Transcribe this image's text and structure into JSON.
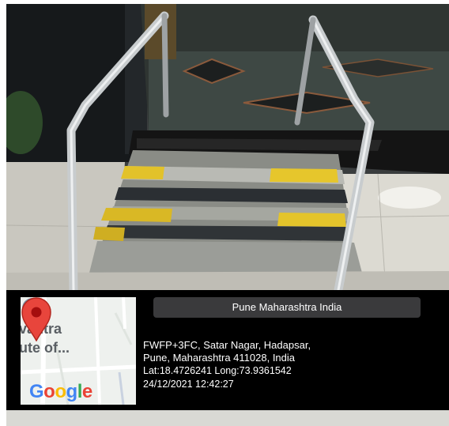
{
  "location_title": "Pune Maharashtra India",
  "address_line1": "FWFP+3FC, Satar Nagar, Hadapsar,",
  "address_line2": "Pune, Maharashtra 411028, India",
  "coordinates": "Lat:18.4726241 Long:73.9361542",
  "timestamp": "24/12/2021 12:42:27",
  "map": {
    "label_line1": "vantra",
    "label_line2": "ute of...",
    "logo_letters": [
      "G",
      "o",
      "o",
      "g",
      "l",
      "e"
    ],
    "logo_colors": [
      "#4285F4",
      "#EA4335",
      "#FBBC05",
      "#4285F4",
      "#34A853",
      "#EA4335"
    ],
    "pin_color": "#E8453C",
    "place_icon": "graduation-cap-icon"
  }
}
